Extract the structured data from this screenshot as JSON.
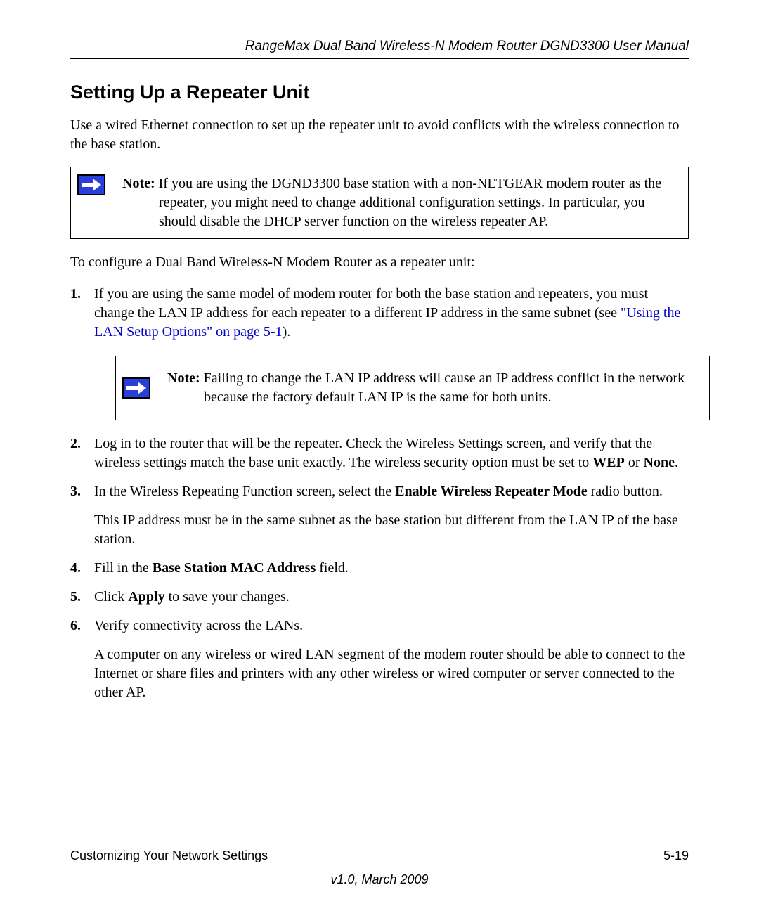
{
  "header": {
    "title": "RangeMax Dual Band Wireless-N Modem Router DGND3300 User Manual"
  },
  "section": {
    "title": "Setting Up a Repeater Unit",
    "intro": "Use a wired Ethernet connection to set up the repeater unit to avoid conflicts with the wireless connection to the base station."
  },
  "note1": {
    "label": "Note:",
    "text": " If you are using the DGND3300 base station with a non-NETGEAR modem router as the repeater, you might need to change additional configuration settings. In particular, you should disable the DHCP server function on the wireless repeater AP."
  },
  "transition": "To configure a Dual Band Wireless-N Modem Router as a repeater unit:",
  "steps": {
    "s1_pre": "If you are using the same model of modem router for both the base station and repeaters, you must change the LAN IP address for each repeater to a different IP address in the same subnet (see ",
    "s1_link": "\"Using the LAN Setup Options\" on page 5-1",
    "s1_post": ").",
    "s2_a": "Log in to the router that will be the repeater. Check the Wireless Settings screen, and verify that the wireless settings match the base unit exactly. The wireless security option must be set to ",
    "s2_b": "WEP",
    "s2_c": " or ",
    "s2_d": "None",
    "s2_e": ".",
    "s3_a": "In the Wireless Repeating Function screen, select the ",
    "s3_b": "Enable Wireless Repeater Mode",
    "s3_c": " radio button.",
    "s3_extra": "This IP address must be in the same subnet as the base station but different from the LAN IP of the base station.",
    "s4_a": "Fill in the ",
    "s4_b": "Base Station MAC Address",
    "s4_c": " field.",
    "s5_a": "Click ",
    "s5_b": "Apply",
    "s5_c": " to save your changes.",
    "s6": "Verify connectivity across the LANs.",
    "s6_extra": "A computer on any wireless or wired LAN segment of the modem router should be able to connect to the Internet or share files and printers with any other wireless or wired computer or server connected to the other AP."
  },
  "note2": {
    "label": "Note:",
    "text": " Failing to change the LAN IP address will cause an IP address conflict in the network because the factory default LAN IP is the same for both units."
  },
  "footer": {
    "left": "Customizing Your Network Settings",
    "right": "5-19",
    "version": "v1.0, March 2009"
  },
  "numbers": {
    "n1": "1.",
    "n2": "2.",
    "n3": "3.",
    "n4": "4.",
    "n5": "5.",
    "n6": "6."
  }
}
